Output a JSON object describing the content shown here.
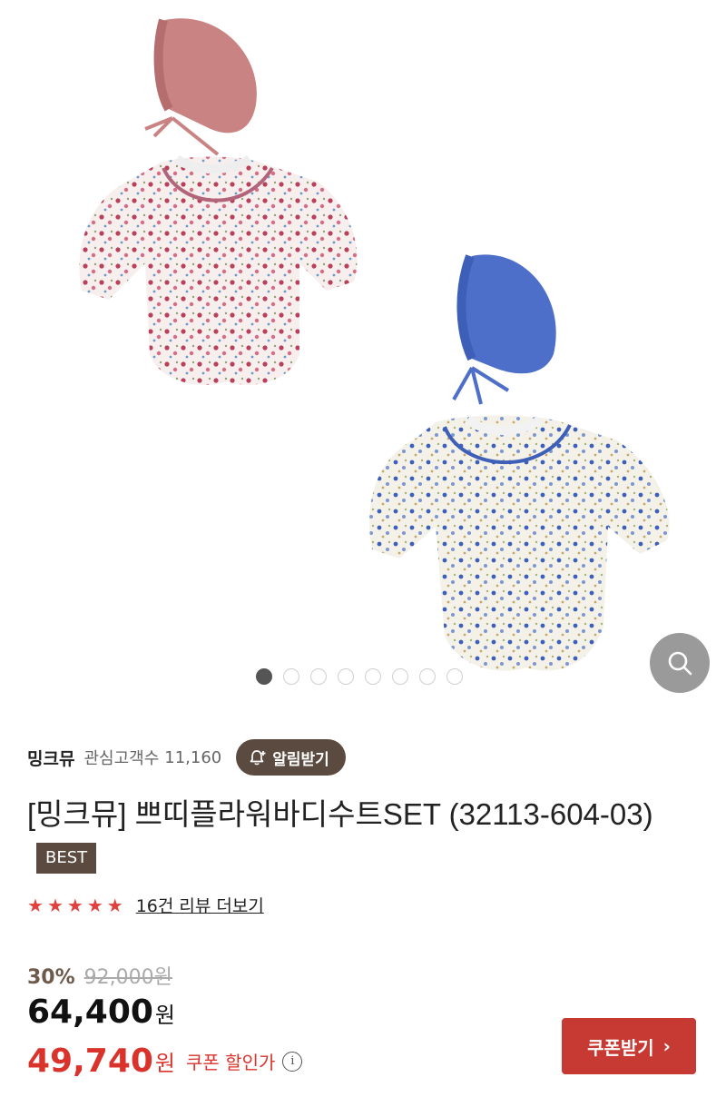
{
  "gallery": {
    "total_images": 8,
    "active_index": 0
  },
  "brand": {
    "name": "밍크뮤",
    "followers_label": "관심고객수",
    "followers_count": "11,160",
    "alarm_label": "알림받기"
  },
  "product": {
    "title": "[밍크뮤] 쁘띠플라워바디수트SET (32113-604-03)",
    "badge": "BEST"
  },
  "rating": {
    "stars": 5,
    "max_stars": 5,
    "review_link": "16건 리뷰 더보기"
  },
  "price": {
    "discount_rate": "30%",
    "original": "92,000원",
    "sale_amount": "64,400",
    "sale_unit": "원",
    "coupon_amount": "49,740",
    "coupon_unit": "원",
    "coupon_label": "쿠폰 할인가",
    "info_icon": "i"
  },
  "coupon_button": {
    "label": "쿠폰받기",
    "chevron": "›"
  },
  "colors": {
    "brown": "#5b4a3f",
    "red": "#c73a34",
    "star": "#e0413c"
  }
}
